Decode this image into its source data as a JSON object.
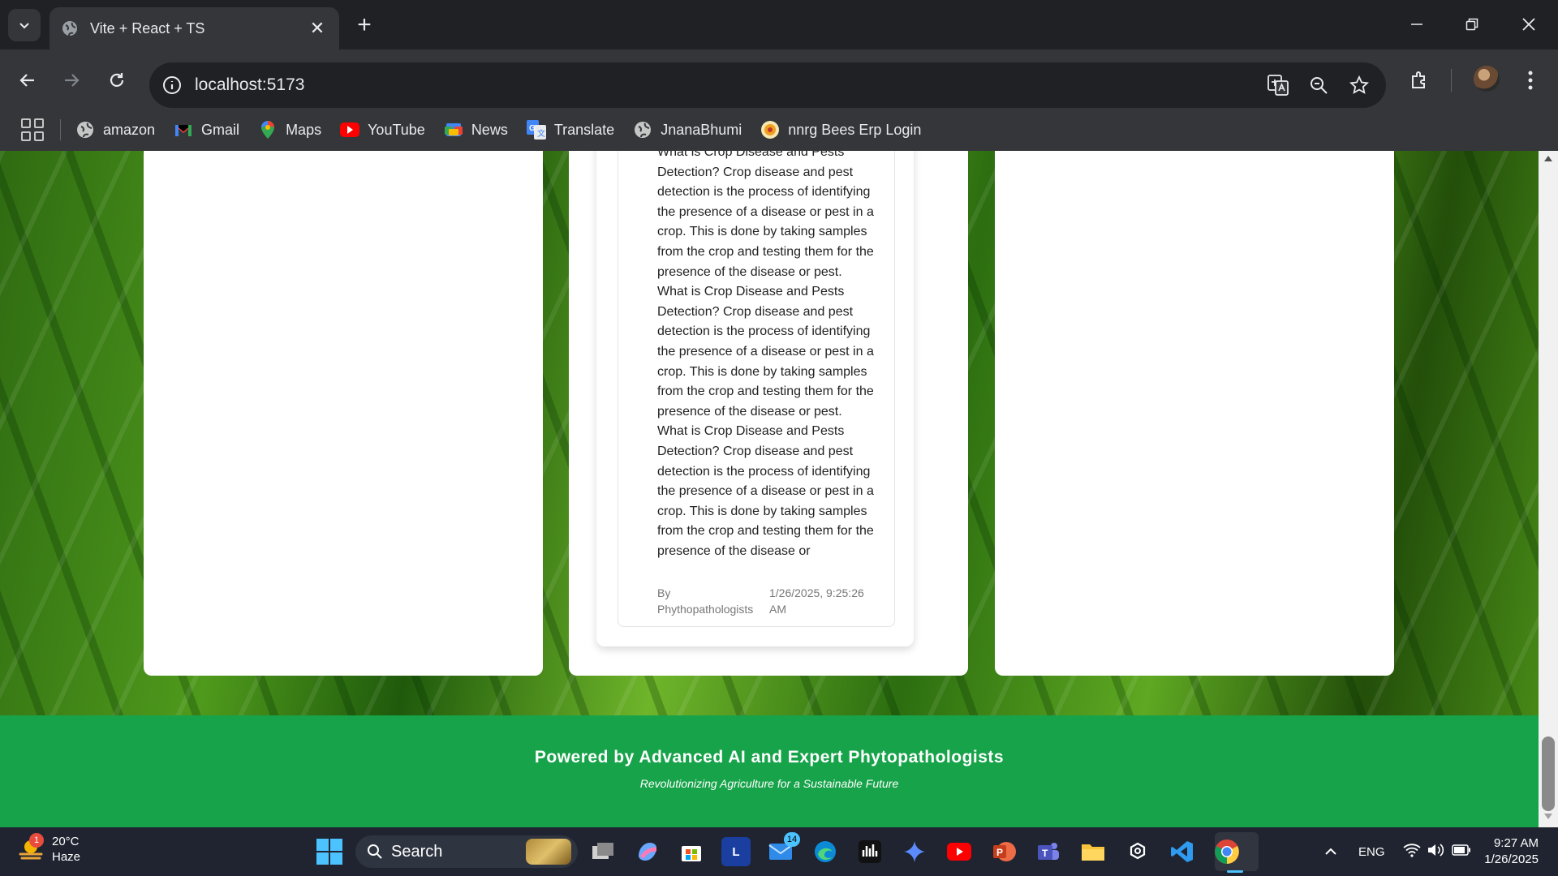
{
  "browser": {
    "tab_title": "Vite + React + TS",
    "url": "localhost:5173",
    "bookmarks": [
      {
        "label": "amazon",
        "icon": "globe-icon"
      },
      {
        "label": "Gmail",
        "icon": "gmail-icon"
      },
      {
        "label": "Maps",
        "icon": "maps-icon"
      },
      {
        "label": "YouTube",
        "icon": "youtube-icon"
      },
      {
        "label": "News",
        "icon": "news-icon"
      },
      {
        "label": "Translate",
        "icon": "translate-icon"
      },
      {
        "label": "JnanaBhumi",
        "icon": "globe-icon"
      },
      {
        "label": "nnrg Bees Erp Login",
        "icon": "nnrg-icon"
      }
    ]
  },
  "post": {
    "paragraphs": [
      "What is Crop Disease and Pests Detection? Crop disease and pest detection is the process of identifying the presence of a disease or pest in a crop. This is done by taking samples from the crop and testing them for the presence of the disease or pest.",
      "What is Crop Disease and Pests Detection? Crop disease and pest detection is the process of identifying the presence of a disease or pest in a crop. This is done by taking samples from the crop and testing them for the presence of the disease or pest.",
      "What is Crop Disease and Pests Detection? Crop disease and pest detection is the process of identifying the presence of a disease or pest in a crop. This is done by taking samples from the crop and testing them for the presence of the disease or"
    ],
    "author": "By Phythopathologists",
    "date": "1/26/2025, 9:25:26 AM"
  },
  "footer": {
    "title": "Powered by Advanced AI and Expert Phytopathologists",
    "subtitle": "Revolutionizing Agriculture for a Sustainable Future"
  },
  "taskbar": {
    "weather_temp": "20°C",
    "weather_desc": "Haze",
    "weather_badge": "1",
    "search_label": "Search",
    "mail_badge": "14",
    "language": "ENG",
    "time": "9:27 AM",
    "date": "1/26/2025"
  },
  "colors": {
    "footer_green": "#17a34a",
    "accent_blue": "#4cc2ff"
  }
}
